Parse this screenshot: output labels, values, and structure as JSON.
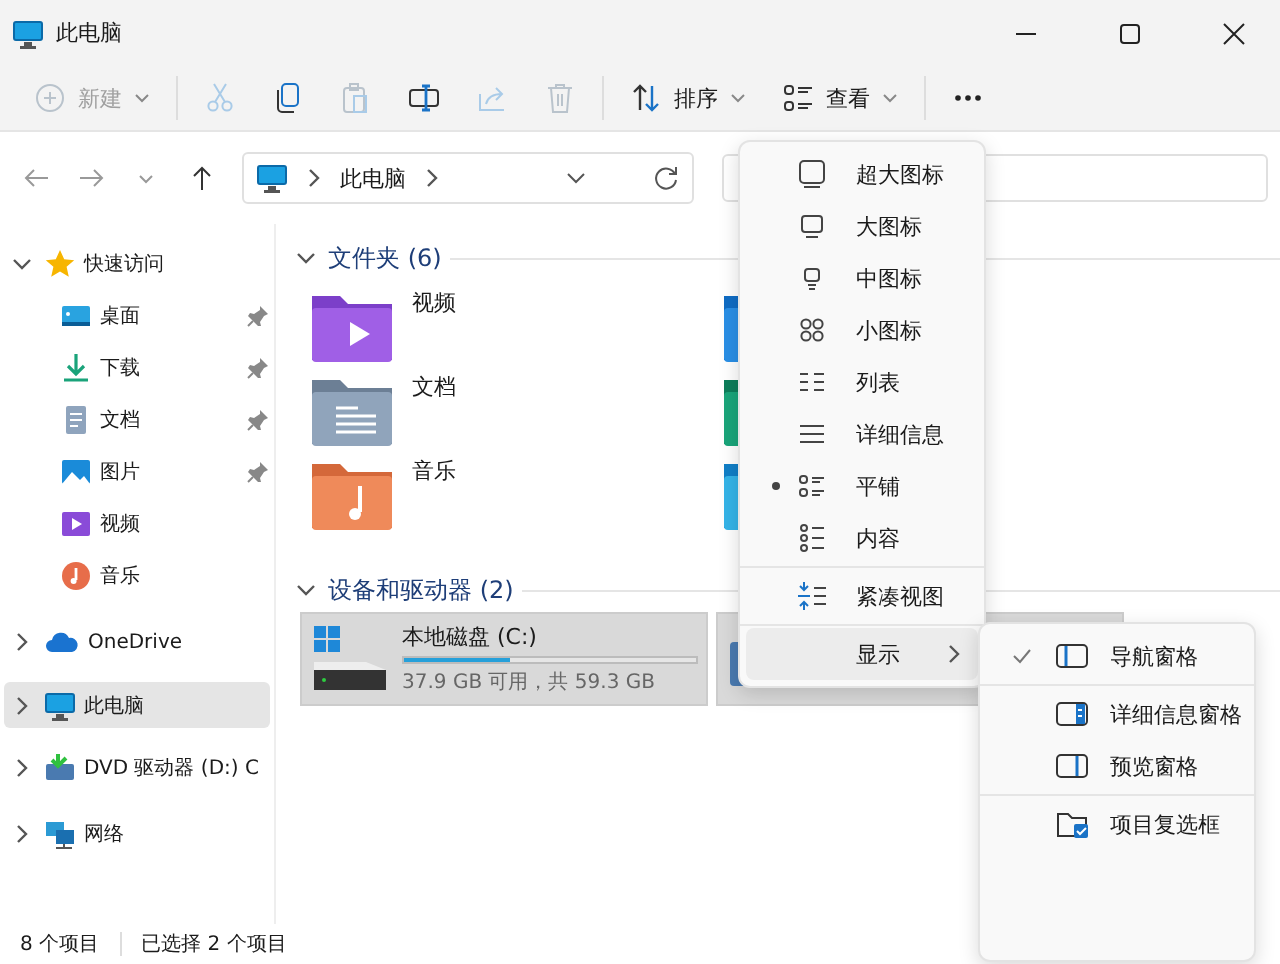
{
  "window": {
    "title": "此电脑"
  },
  "toolbar": [
    {
      "kind": "new",
      "label": "新建",
      "disabled": true
    },
    {
      "kind": "cut",
      "disabled": true
    },
    {
      "kind": "copy",
      "disabled": false
    },
    {
      "kind": "paste",
      "disabled": true
    },
    {
      "kind": "rename",
      "disabled": false
    },
    {
      "kind": "share",
      "disabled": true
    },
    {
      "kind": "delete",
      "disabled": true
    },
    {
      "kind": "sort",
      "label": "排序",
      "disabled": false
    },
    {
      "kind": "view",
      "label": "查看",
      "disabled": false
    },
    {
      "kind": "more",
      "disabled": false
    }
  ],
  "address": {
    "path": [
      "此电脑"
    ]
  },
  "sidebar": [
    {
      "kind": "star",
      "label": "快速访问",
      "expanded": true,
      "selected": false,
      "children": [
        {
          "kind": "desktop",
          "label": "桌面",
          "pinned": true,
          "selected": false
        },
        {
          "kind": "download",
          "label": "下载",
          "pinned": true,
          "selected": false
        },
        {
          "kind": "document",
          "label": "文档",
          "pinned": true,
          "selected": false
        },
        {
          "kind": "picture",
          "label": "图片",
          "pinned": true,
          "selected": false
        },
        {
          "kind": "video",
          "label": "视频",
          "pinned": false,
          "selected": false
        },
        {
          "kind": "music",
          "label": "音乐",
          "pinned": false,
          "selected": false
        }
      ]
    },
    {
      "kind": "cloud",
      "label": "OneDrive",
      "expanded": false,
      "selected": false
    },
    {
      "kind": "pc",
      "label": "此电脑",
      "expanded": false,
      "selected": true
    },
    {
      "kind": "dvd",
      "label": "DVD 驱动器 (D:) C",
      "expanded": false,
      "selected": false
    },
    {
      "kind": "network",
      "label": "网络",
      "expanded": false,
      "selected": false
    }
  ],
  "folders": {
    "title": "文件夹 (6)",
    "items": [
      {
        "kind": "video",
        "name": "视频"
      },
      {
        "kind": "desktop"
      },
      {
        "kind": "document",
        "name": "文档"
      },
      {
        "kind": "download"
      },
      {
        "kind": "music",
        "name": "音乐"
      },
      {
        "kind": "picture"
      }
    ]
  },
  "drives": {
    "title": "设备和驱动器 (2)",
    "items": [
      {
        "kind": "disk",
        "name": "本地磁盘 (C:)",
        "level": 0.36,
        "free": "37.9 GB 可用，共 59.3 GB",
        "selected": true
      },
      {
        "kind": "dvd",
        "selected": true
      }
    ]
  },
  "view_menu": [
    {
      "kind": "xl",
      "label": "超大图标",
      "selected": false
    },
    {
      "kind": "large",
      "label": "大图标",
      "selected": false
    },
    {
      "kind": "medium",
      "label": "中图标",
      "selected": false
    },
    {
      "kind": "small",
      "label": "小图标",
      "selected": false
    },
    {
      "kind": "list",
      "label": "列表",
      "selected": false
    },
    {
      "kind": "details",
      "label": "详细信息",
      "selected": false
    },
    {
      "kind": "tiles",
      "label": "平铺",
      "selected": true
    },
    {
      "kind": "content",
      "label": "内容",
      "selected": false
    },
    {
      "kind": "compact",
      "label": "紧凑视图",
      "selected": false
    },
    {
      "kind": "show",
      "label": "显示",
      "selected": false
    }
  ],
  "show_menu": [
    {
      "kind": "nav",
      "label": "导航窗格",
      "checked": true
    },
    {
      "kind": "details",
      "label": "详细信息窗格",
      "checked": false
    },
    {
      "kind": "preview",
      "label": "预览窗格",
      "checked": false
    },
    {
      "kind": "checkbox",
      "label": "项目复选框",
      "checked": false
    }
  ],
  "status_bar": [
    "8 个项目",
    "已选择 2 个项目"
  ]
}
